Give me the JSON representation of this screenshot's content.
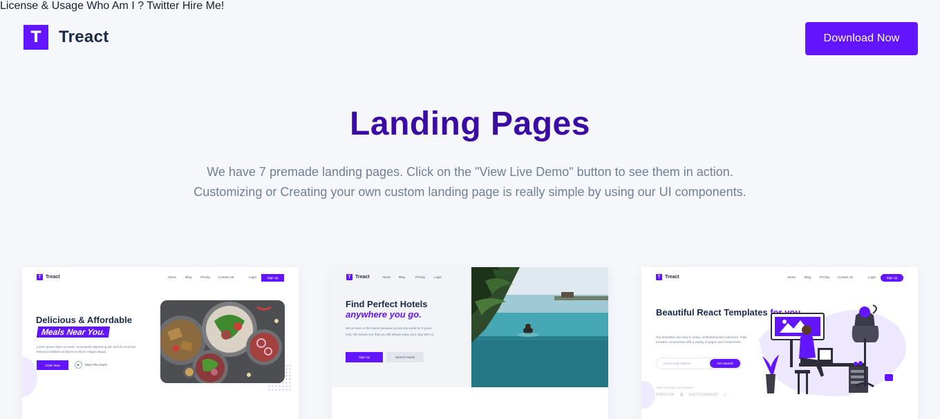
{
  "header": {
    "logo_letter": "T",
    "logo_text": "Treact",
    "nav": [
      "License & Usage",
      "Who Am I ?",
      "Twitter",
      "Hire Me!"
    ],
    "cta": "Download Now"
  },
  "hero": {
    "title": "Landing Pages",
    "desc_line1": "We have 7 premade landing pages. Click on the \"View Live Demo\" button to see them in action.",
    "desc_line2": "Customizing or Creating your own custom landing page is really simple by using our UI components."
  },
  "cards": [
    {
      "logo": "Treact",
      "links": [
        "About",
        "Blog",
        "Pricing",
        "Contact Us"
      ],
      "login": "Login",
      "signup": "Sign Up",
      "heading": "Delicious & Affordable",
      "highlight": "Meals Near You.",
      "text": "Lorem ipsum dolor sit amet, consectetur adipiscing elit, sed do eiusmod tempor incididunt ut labore et dolore magna aliqua.",
      "button": "Order Now",
      "secondary": "Meet The Chefs"
    },
    {
      "logo": "Treact",
      "links": [
        "About",
        "Blog",
        "Pricing",
        "Login"
      ],
      "heading": "Find Perfect Hotels",
      "highlight": "anywhere you go.",
      "text": "We've been in the hotels business across the world for 5 years now. We assure you that you will always enjoy your stay with us.",
      "button": "Sign Up",
      "secondary": "Search Hotels"
    },
    {
      "logo": "Treact",
      "links": [
        "About",
        "Blog",
        "Pricing",
        "Contact Us"
      ],
      "login": "Login",
      "signup": "Sign Up",
      "heading": "Beautiful React Templates",
      "highlight": "for you.",
      "text": "Our templates are easy to setup, understand and customize. Fully modular components with a variety of pages and components.",
      "input_placeholder": "Your E-mail Address",
      "button": "Get Started",
      "trusted": "OUR TRUSTED CUSTOMERS",
      "customer_logos": [
        "FORTUNE",
        "FAST COMPANY"
      ]
    }
  ],
  "colors": {
    "accent": "#6415ff",
    "title": "#3a0ca3",
    "background": "#f5f7fb"
  }
}
